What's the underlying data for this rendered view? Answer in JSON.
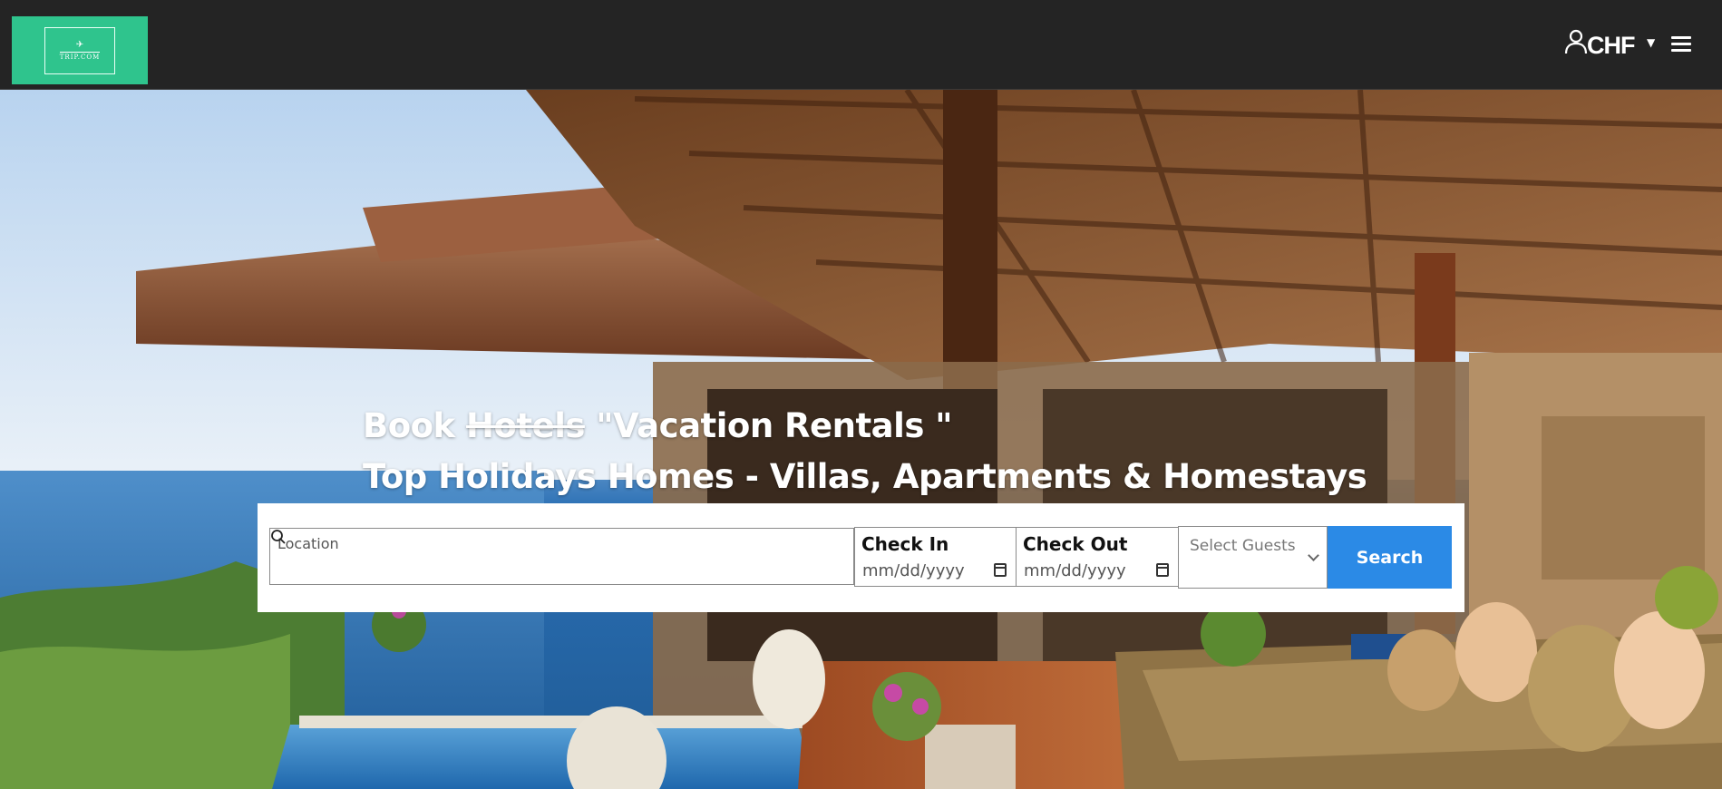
{
  "header": {
    "logo_text": "TRIP.COM",
    "currency": "CHF",
    "icons": [
      "user-icon",
      "chevron-down-icon",
      "menu-icon"
    ],
    "background": "#242424",
    "logo_color": "#2fc48d"
  },
  "hero": {
    "headline_prefix": "Book ",
    "headline_struck": "Hotels",
    "headline_rest": " \"Vacation Rentals \"",
    "subheadline": "Top Holidays Homes - Villas, Apartments & Homestays"
  },
  "search": {
    "location_label": "Location",
    "location_value": "",
    "checkin_label": "Check In",
    "checkin_placeholder": "mm/dd/yyyy",
    "checkout_label": "Check Out",
    "checkout_placeholder": "mm/dd/yyyy",
    "guests_placeholder": "Select Guests",
    "search_label": "Search",
    "accent": "#2b8ae6"
  }
}
